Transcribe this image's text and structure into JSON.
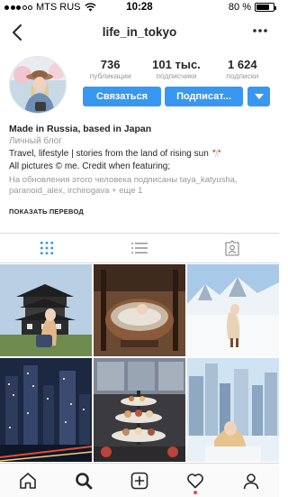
{
  "status_bar": {
    "carrier": "MTS RUS",
    "time": "10:28",
    "battery_percent_label": "80 %",
    "battery_level": 0.8
  },
  "nav": {
    "title": "life_in_tokyo",
    "back_icon": "chevron-left-icon",
    "more_icon": "more-dots-icon"
  },
  "profile": {
    "stats": [
      {
        "value": "736",
        "label": "публикации"
      },
      {
        "value": "101 тыс.",
        "label": "подписчики"
      },
      {
        "value": "1 624",
        "label": "подписки"
      }
    ],
    "message_button": "Связаться",
    "follow_button": "Подписат...",
    "dropdown_icon": "caret-down-icon"
  },
  "bio": {
    "name": "Made in Russia, based in Japan",
    "category": "Личный блог",
    "line1": "Travel, lifestyle | stories from the land of rising sun 🎌",
    "line2": "All pictures © me. Credit when featuring;",
    "followers_note": "На обновления этого человека подписаны taya_katyusha, paranoid_alex, irchirogava + еще 1",
    "translate": "ПОКАЗАТЬ ПЕРЕВОД"
  },
  "tabs": [
    {
      "icon": "grid-icon",
      "active": true
    },
    {
      "icon": "list-icon",
      "active": false
    },
    {
      "icon": "tagged-icon",
      "active": false
    }
  ],
  "bottom_nav": [
    {
      "icon": "home-icon"
    },
    {
      "icon": "search-icon",
      "active": true
    },
    {
      "icon": "add-post-icon"
    },
    {
      "icon": "activity-heart-icon",
      "notification": true
    },
    {
      "icon": "profile-icon"
    }
  ],
  "colors": {
    "accent": "#3897f0",
    "text": "#262626",
    "muted": "#999999",
    "border": "#dbdbdb",
    "notification": "#ed4956"
  }
}
